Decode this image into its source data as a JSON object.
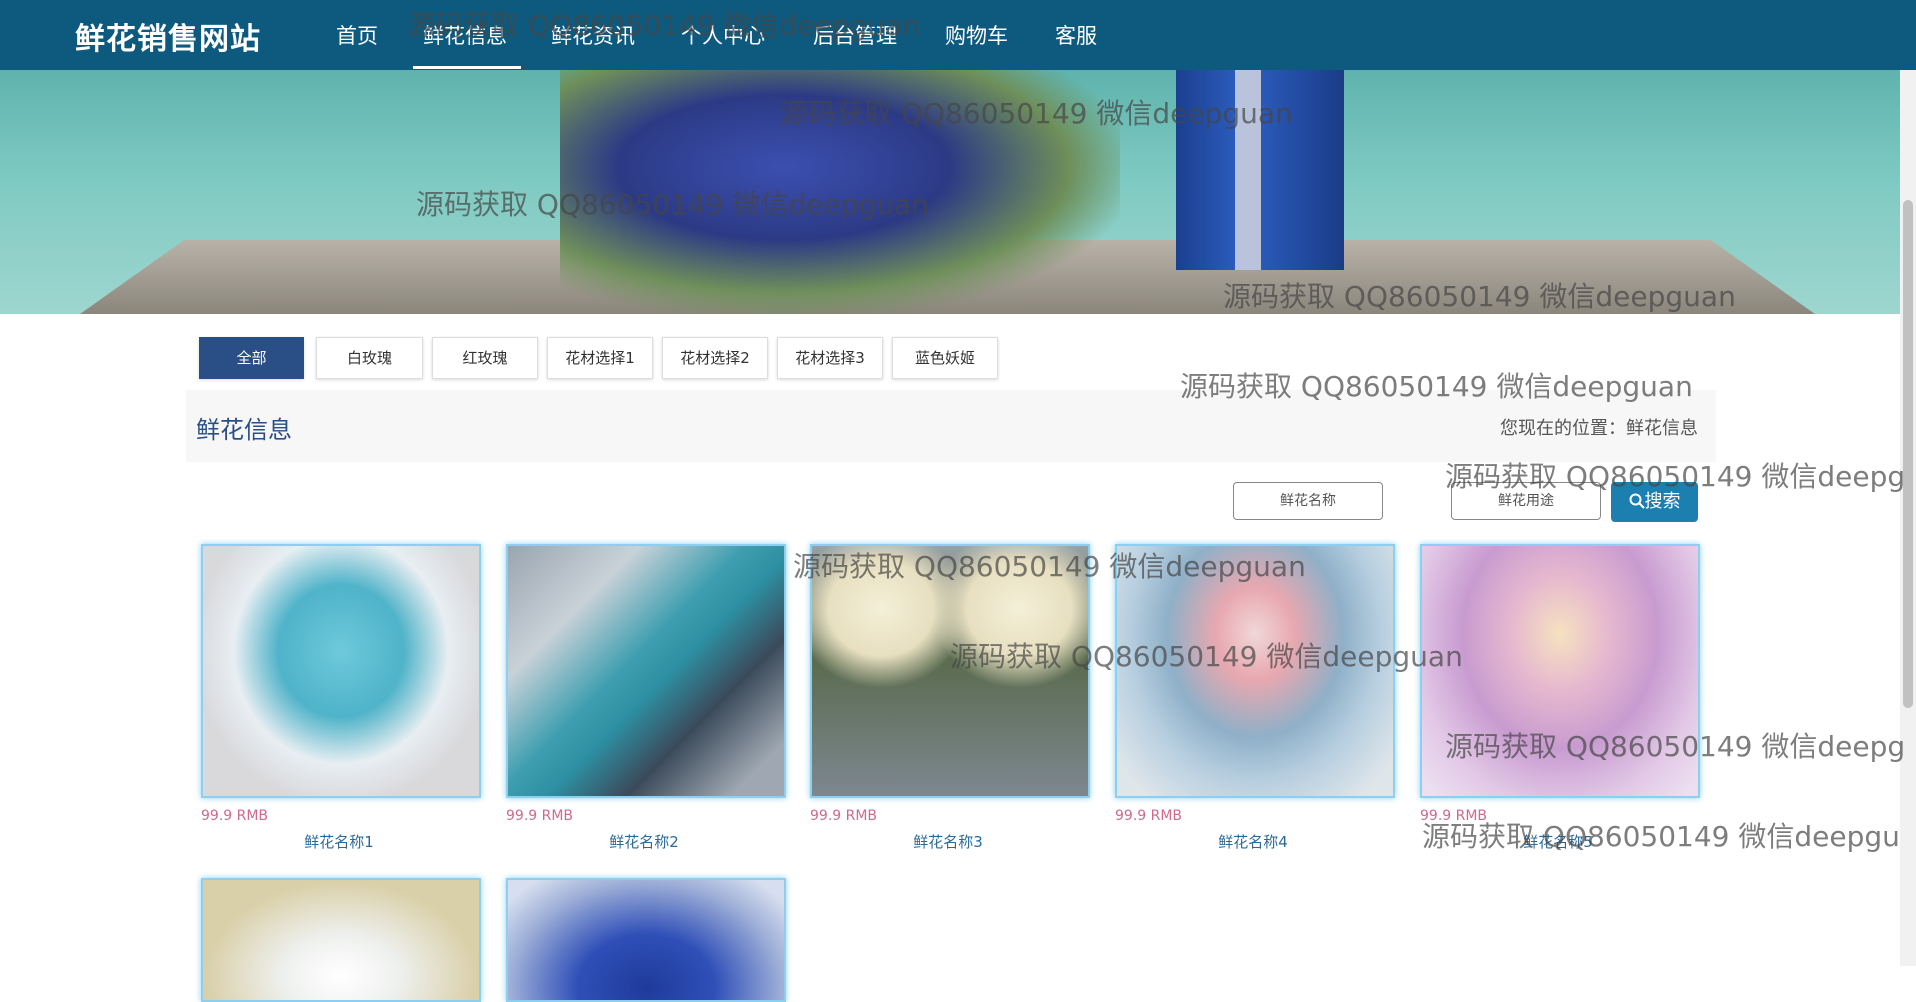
{
  "site_title": "鲜花销售网站",
  "nav": [
    "首页",
    "鲜花信息",
    "鲜花资讯",
    "个人中心",
    "后台管理",
    "购物车",
    "客服"
  ],
  "categories": [
    "全部",
    "白玫瑰",
    "红玫瑰",
    "花材选择1",
    "花材选择2",
    "花材选择3",
    "蓝色妖姬"
  ],
  "page_title": "鲜花信息",
  "location": "您现在的位置：鲜花信息",
  "search": {
    "name_placeholder": "鲜花名称",
    "use_placeholder": "鲜花用途",
    "button_label": "搜索"
  },
  "products": [
    {
      "price": "99.9 RMB",
      "name": "鲜花名称1"
    },
    {
      "price": "99.9 RMB",
      "name": "鲜花名称2"
    },
    {
      "price": "99.9 RMB",
      "name": "鲜花名称3"
    },
    {
      "price": "99.9 RMB",
      "name": "鲜花名称4"
    },
    {
      "price": "99.9 RMB",
      "name": "鲜花名称5"
    }
  ],
  "watermarks": [
    "源码获取 QQ86050149 微信deepguan",
    "源码获取 QQ86050149 微信deepguan",
    "源码获取 QQ86050149 微信deepguan",
    "源码获取 QQ86050149 微信deepguan",
    "源码获取 QQ86050149 微信deepguan",
    "源码获取 QQ86050149 微信deepg",
    "源码获取 QQ86050149 微信deepguan",
    "源码获取 QQ86050149 微信deepguan",
    "源码获取 QQ86050149 微信deepg",
    "源码获取 QQ86050149 微信deepgu"
  ],
  "colors": {
    "nav_bg": "#0e5a7f",
    "accent": "#2a4f86",
    "search_btn": "#1b7fb0",
    "price": "#d06a8a"
  }
}
